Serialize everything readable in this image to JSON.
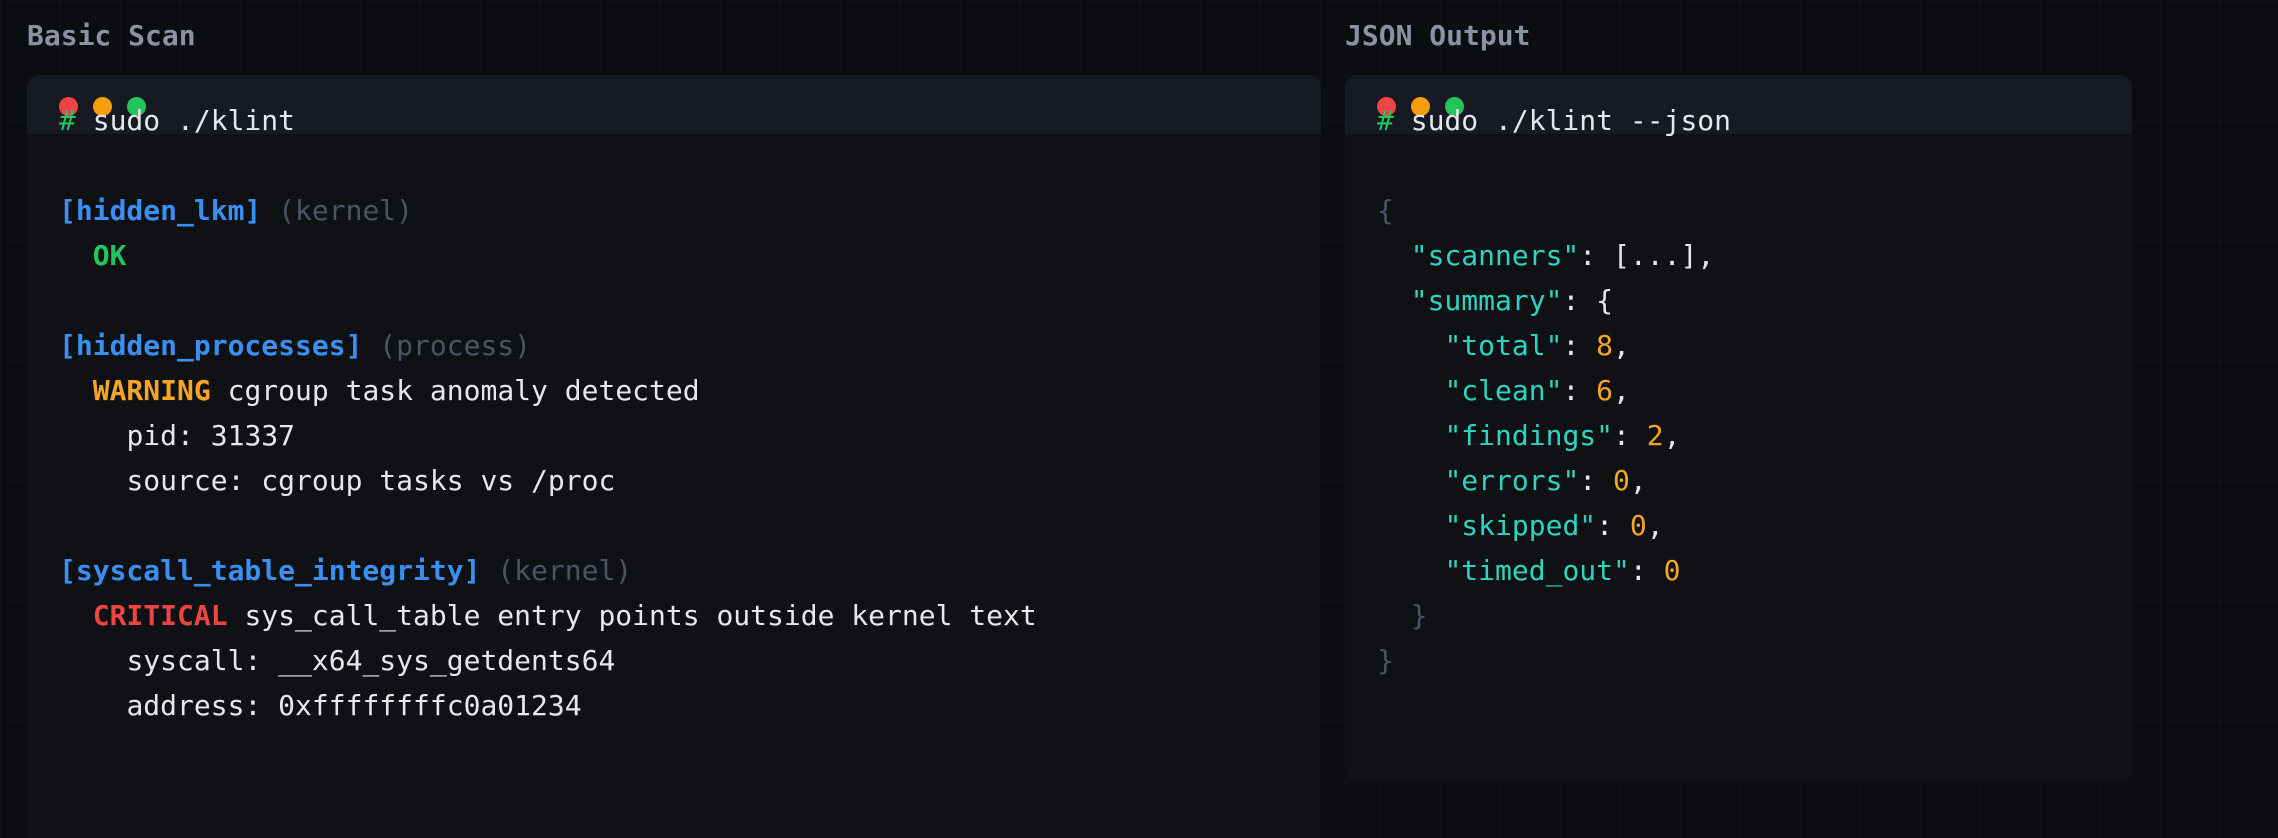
{
  "left": {
    "title": "Basic Scan",
    "prompt": "#",
    "command": "sudo ./klint",
    "results": [
      {
        "scanner": "[hidden_lkm]",
        "category": "(kernel)",
        "status": "OK",
        "message": "",
        "details": []
      },
      {
        "scanner": "[hidden_processes]",
        "category": "(process)",
        "status": "WARNING",
        "message": "cgroup task anomaly detected",
        "details": [
          "pid: 31337",
          "source: cgroup tasks vs /proc"
        ]
      },
      {
        "scanner": "[syscall_table_integrity]",
        "category": "(kernel)",
        "status": "CRITICAL",
        "message": "sys_call_table entry points outside kernel text",
        "details": [
          "syscall: __x64_sys_getdents64",
          "address: 0xffffffffc0a01234"
        ]
      }
    ]
  },
  "right": {
    "title": "JSON Output",
    "prompt": "#",
    "command": "sudo ./klint --json",
    "json": {
      "open_brace": "{",
      "close_brace": "}",
      "scanners_key": "\"scanners\"",
      "scanners_value": "[...]",
      "summary_key": "\"summary\"",
      "summary_open": "{",
      "summary_close": "}",
      "fields": [
        {
          "key": "\"total\"",
          "value": "8"
        },
        {
          "key": "\"clean\"",
          "value": "6"
        },
        {
          "key": "\"findings\"",
          "value": "2"
        },
        {
          "key": "\"errors\"",
          "value": "0"
        },
        {
          "key": "\"skipped\"",
          "value": "0"
        },
        {
          "key": "\"timed_out\"",
          "value": "0"
        }
      ]
    }
  },
  "colors": {
    "background": "#0b0d11",
    "terminal_bg": "#0f1115",
    "titlebar_bg": "#171a22",
    "prompt": "#22c55e",
    "scanner": "#3b8ff0",
    "ok": "#22c55e",
    "warning": "#f5a524",
    "critical": "#ef4444",
    "json_key": "#2dd4bf",
    "json_number": "#f5a524"
  }
}
